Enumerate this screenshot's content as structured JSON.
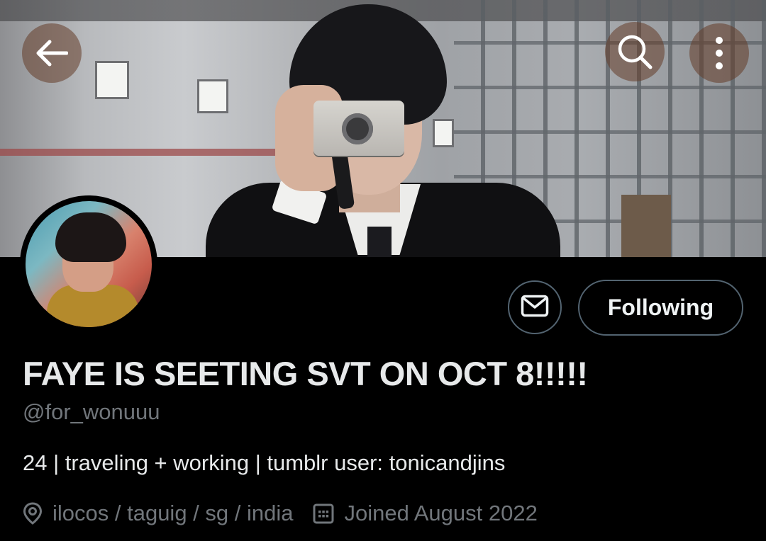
{
  "header": {
    "back_icon": "arrow-left-icon",
    "search_icon": "search-icon",
    "more_icon": "more-vertical-icon"
  },
  "profile": {
    "display_name": "FAYE IS SEETING SVT ON OCT 8!!!!!",
    "handle": "@for_wonuuu",
    "bio": "24 | traveling + working | tumblr user: tonicandjins",
    "location": "ilocos / taguig / sg / india",
    "joined": "Joined August 2022"
  },
  "actions": {
    "message_icon": "envelope-icon",
    "follow_label": "Following"
  },
  "colors": {
    "background": "#000000",
    "text_primary": "#e7e9ea",
    "text_secondary": "#71767b",
    "border": "#536471"
  }
}
